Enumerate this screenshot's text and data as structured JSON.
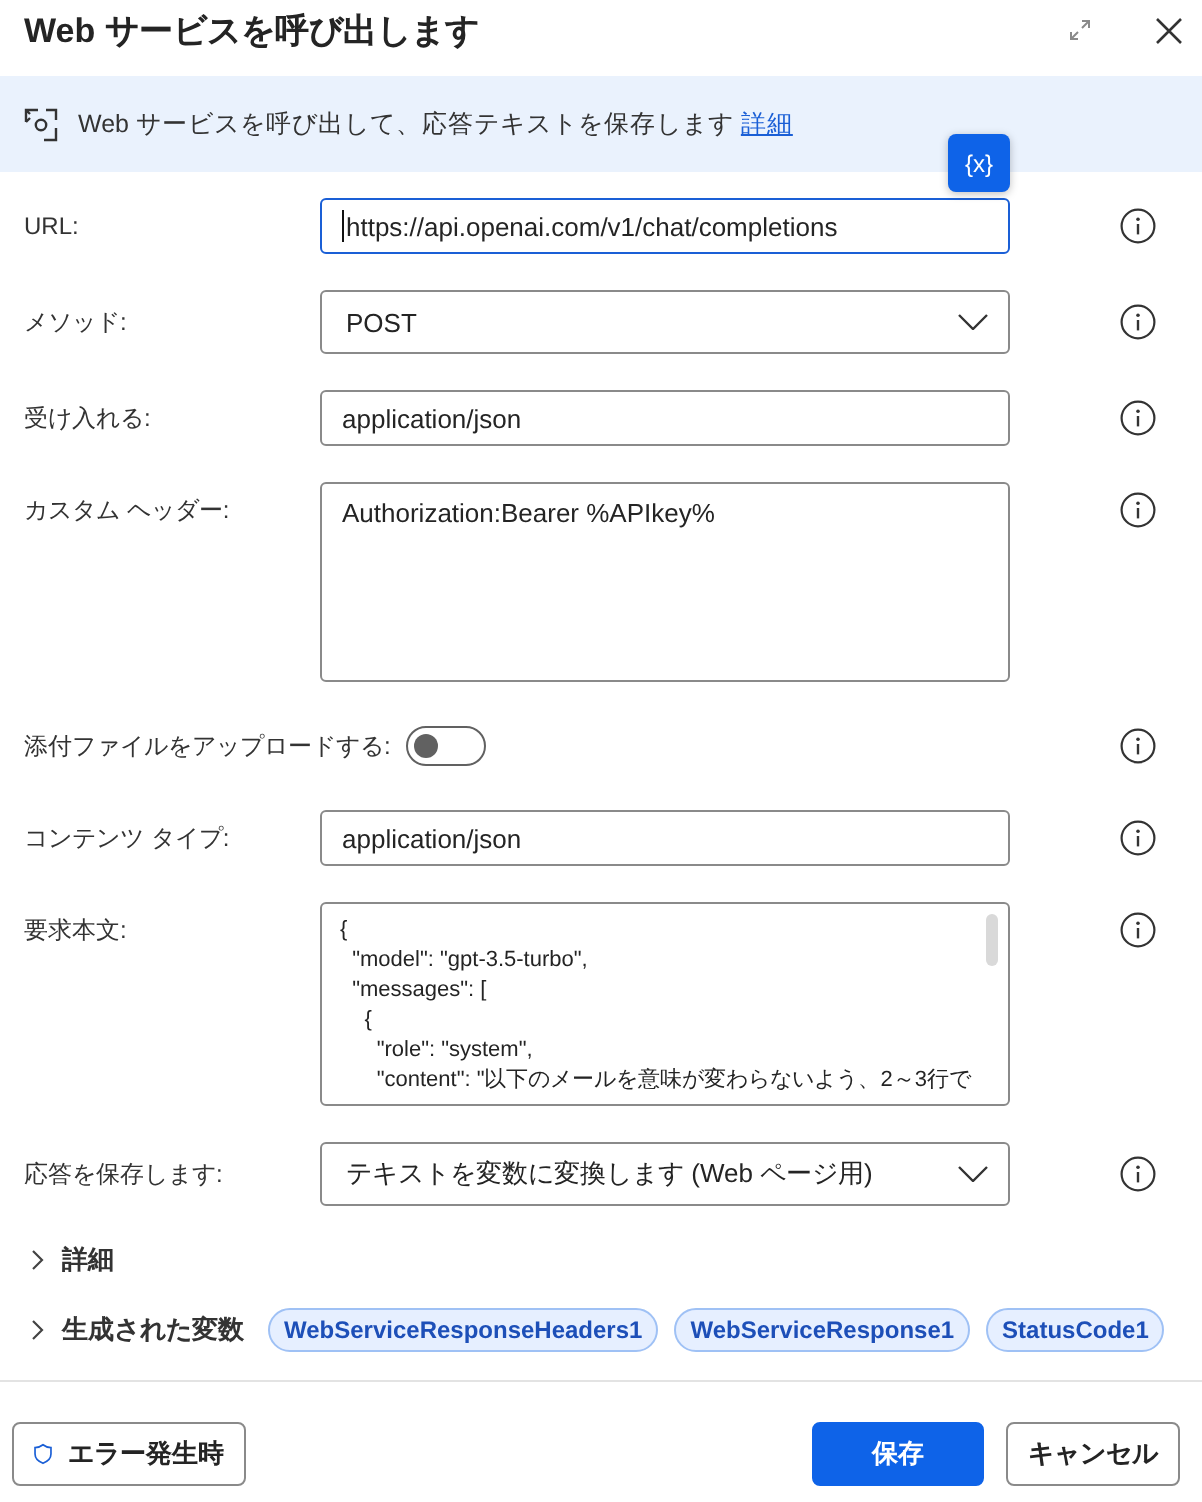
{
  "window": {
    "title": "Web サービスを呼び出します"
  },
  "banner": {
    "text": "Web サービスを呼び出して、応答テキストを保存します",
    "link": "詳細"
  },
  "variable_button": {
    "label": "{x}"
  },
  "fields": [
    {
      "kind": "text",
      "label": "URL:",
      "value": "https://api.openai.com/v1/chat/completions",
      "focused": true
    },
    {
      "kind": "select",
      "label": "メソッド:",
      "value": "POST",
      "focused": false
    },
    {
      "kind": "text",
      "label": "受け入れる:",
      "value": "application/json",
      "focused": false
    },
    {
      "kind": "textarea",
      "label": "カスタム ヘッダー:",
      "value": "Authorization:Bearer %APIkey%",
      "focused": false
    },
    {
      "kind": "toggle",
      "label": "添付ファイルをアップロードする:",
      "on": false,
      "focused": false
    },
    {
      "kind": "text",
      "label": "コンテンツ タイプ:",
      "value": "application/json",
      "focused": false
    },
    {
      "kind": "code",
      "label": "要求本文:",
      "value": "{\n  \"model\": \"gpt-3.5-turbo\",\n  \"messages\": [\n    {\n      \"role\": \"system\",\n      \"content\": \"以下のメールを意味が変わらないよう、2～3行で",
      "focused": false
    },
    {
      "kind": "select",
      "label": "応答を保存します:",
      "value": "テキストを変数に変換します (Web ページ用)",
      "focused": false
    }
  ],
  "sections": [
    {
      "label": "詳細",
      "expanded": false
    },
    {
      "label": "生成された変数",
      "expanded": false,
      "variables": [
        "WebServiceResponseHeaders1",
        "WebServiceResponse1",
        "StatusCode1"
      ]
    }
  ],
  "footer": {
    "error_button": "エラー発生時",
    "save_button": "保存",
    "cancel_button": "キャンセル"
  }
}
